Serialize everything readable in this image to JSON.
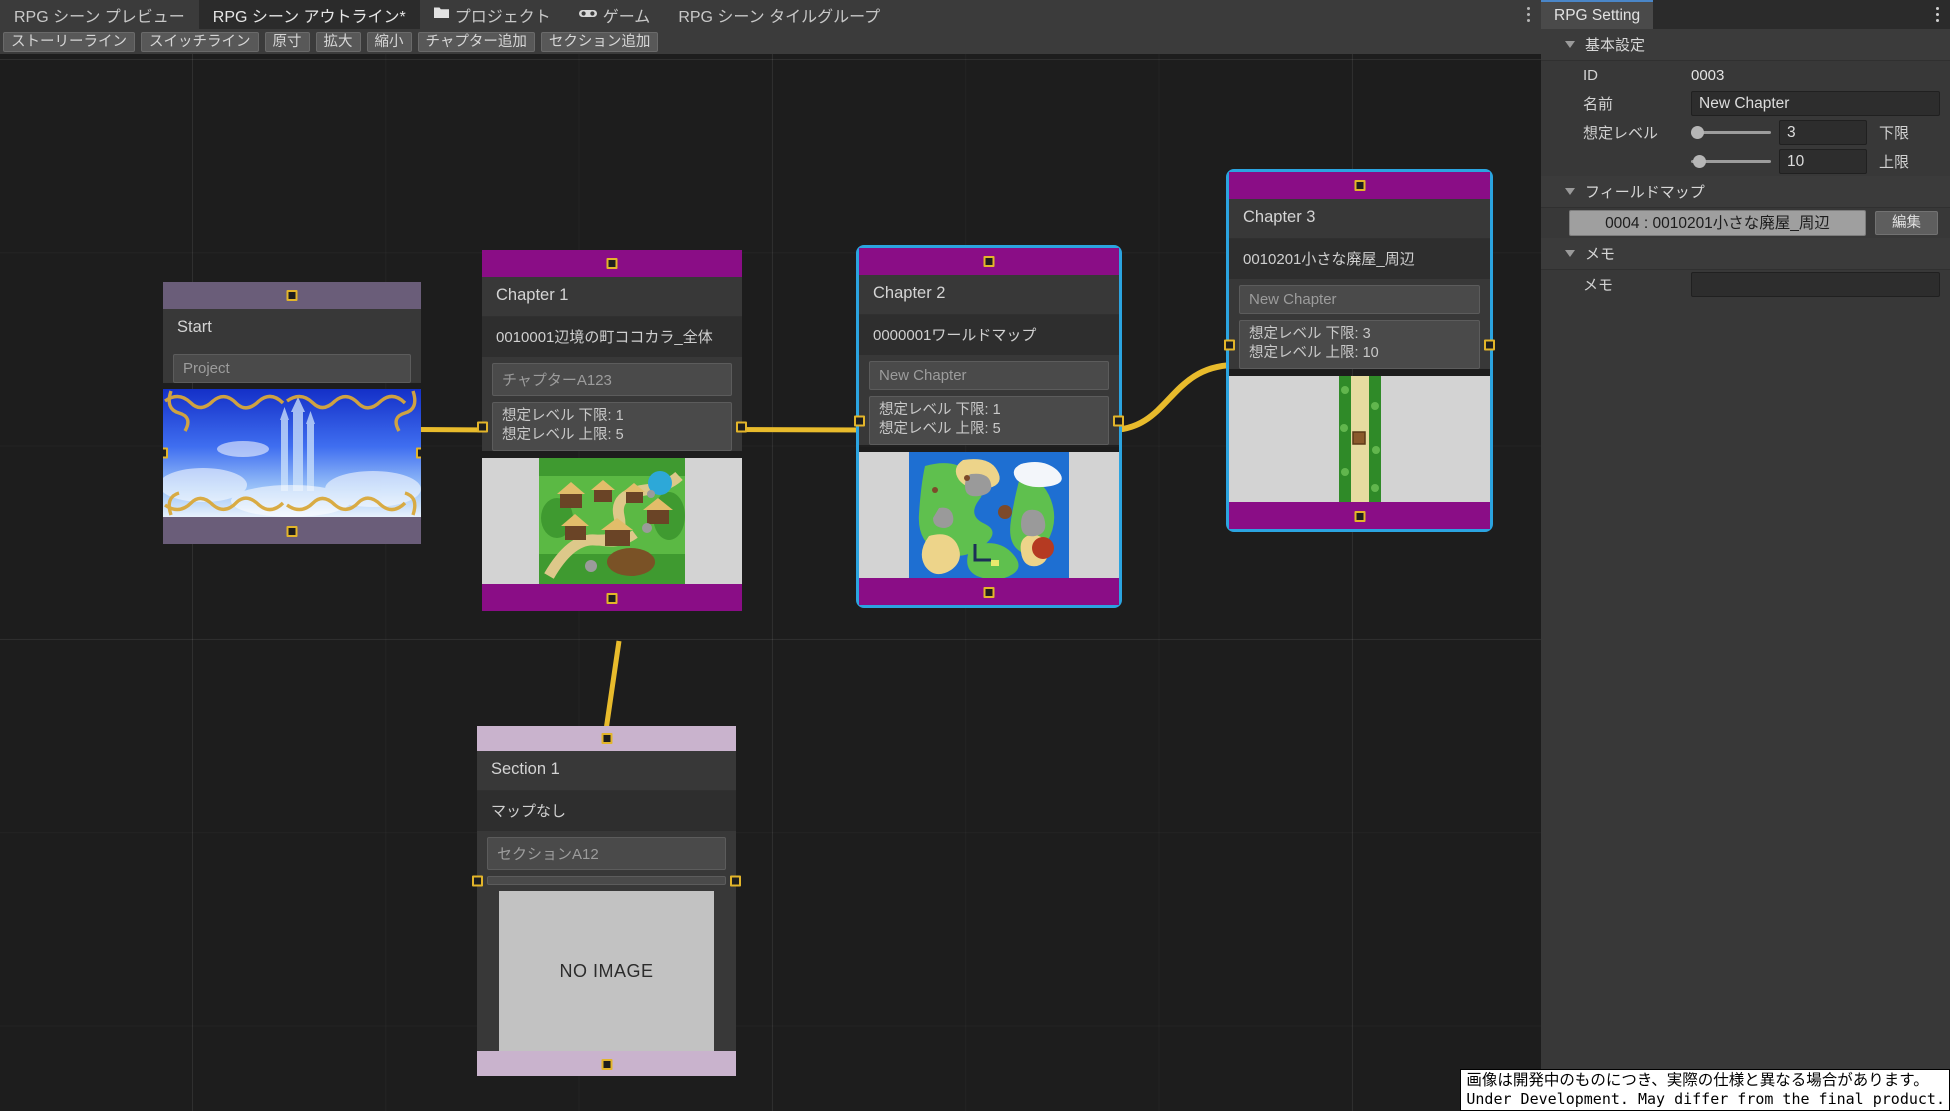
{
  "window": {
    "tabs": [
      {
        "label": "RPG シーン プレビュー",
        "icon": "",
        "active": false
      },
      {
        "label": "RPG シーン アウトライン*",
        "icon": "",
        "active": true
      },
      {
        "label": "プロジェクト",
        "icon": "folder-icon",
        "active": false
      },
      {
        "label": "ゲーム",
        "icon": "gamepad-icon",
        "active": false
      },
      {
        "label": "RPG シーン タイルグループ",
        "icon": "",
        "active": false
      }
    ],
    "kebab_icon": "more-options-icon"
  },
  "toolbar": {
    "buttons": [
      "ストーリーライン",
      "スイッチライン",
      "原寸",
      "拡大",
      "縮小",
      "チャプター追加",
      "セクション追加"
    ]
  },
  "graph": {
    "nodes": [
      {
        "id": "start",
        "kind": "start",
        "title": "Start",
        "field": "Project",
        "bar_color": "#6a5d79",
        "selected": false
      },
      {
        "id": "chapter1",
        "kind": "chapter",
        "title": "Chapter 1",
        "map": "0010001辺境の町ココカラ_全体",
        "field": "チャプターA123",
        "level_lower": "想定レベル 下限: 1",
        "level_upper": "想定レベル 上限: 5",
        "bar_color": "#8a0d86",
        "selected": false
      },
      {
        "id": "chapter2",
        "kind": "chapter",
        "title": "Chapter 2",
        "map": "0000001ワールドマップ",
        "field": "New Chapter",
        "level_lower": "想定レベル 下限: 1",
        "level_upper": "想定レベル 上限: 5",
        "bar_color": "#8a0d86",
        "selected": true
      },
      {
        "id": "chapter3",
        "kind": "chapter",
        "title": "Chapter 3",
        "map": "0010201小さな廃屋_周辺",
        "field": "New Chapter",
        "level_lower": "想定レベル 下限: 3",
        "level_upper": "想定レベル 上限: 10",
        "bar_color": "#8a0d86",
        "selected": true
      },
      {
        "id": "section1",
        "kind": "section",
        "title": "Section 1",
        "map": "マップなし",
        "field": "セクションA12",
        "image_placeholder": "NO IMAGE",
        "bar_color": "#c9b3cd",
        "selected": false
      }
    ],
    "wire_color": "#e8bb2c",
    "selection_color": "#2ba4e0"
  },
  "inspector": {
    "tab_label": "RPG Setting",
    "kebab_icon": "more-options-icon",
    "sections": [
      {
        "label": "基本設定"
      },
      {
        "label": "フィールドマップ"
      },
      {
        "label": "メモ"
      }
    ],
    "basic": {
      "id_label": "ID",
      "id_value": "0003",
      "name_label": "名前",
      "name_value": "New Chapter",
      "level_label": "想定レベル",
      "level_lower_value": "3",
      "level_lower_unit": "下限",
      "level_upper_value": "10",
      "level_upper_unit": "上限"
    },
    "fieldmap": {
      "value": "0004 : 0010201小さな廃屋_周辺",
      "edit_label": "編集"
    },
    "memo": {
      "label": "メモ",
      "value": ""
    }
  },
  "watermark": {
    "line_jp": "画像は開発中のものにつき、実際の仕様と異なる場合があります。",
    "line_en": "Under Development. May differ from the final product."
  }
}
